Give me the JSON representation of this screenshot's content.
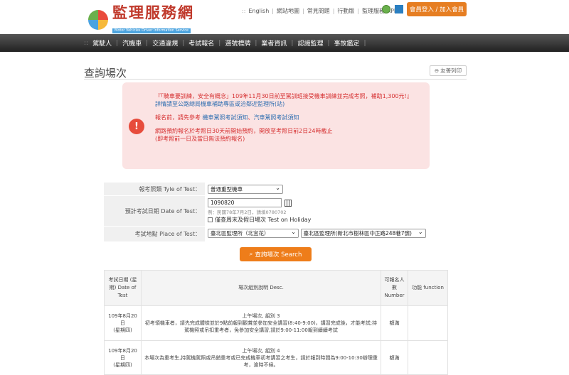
{
  "header": {
    "logo_title": "監理服務網",
    "logo_subtitle": "Motor Vehicles Driver Information Service",
    "links": [
      "English",
      "網站地圖",
      "常見問題",
      "行動版",
      "監理服務 APP"
    ],
    "login_label": "會員登入 / 加入會員"
  },
  "nav": [
    "駕駛人",
    "汽機車",
    "交通違規",
    "考試報名",
    "選號標牌",
    "業者資訊",
    "認識監理",
    "事故鑑定"
  ],
  "page": {
    "title": "查詢場次",
    "print_label": "友善列印"
  },
  "notice": {
    "line1": "『「騎車要訓練，安全有概念」109年11月30日前至駕訓班接受機車訓練並完成考照，補助1,300元!』",
    "line2": "詳情請至公路總局機車補助專區或洽鄰近監理所(站)",
    "line3_prefix": "報名前，請先參考",
    "link1": "機車駕照考試須知",
    "sep": "、",
    "link2": "汽車駕照考試須知",
    "line4": "網路預約報名於考照日30天前開始預約，開放至考照日前2日24時截止",
    "line5": "(即考照前一日及當日無法預約報名)"
  },
  "form": {
    "type_label": "報考照類 Tyle of Test：",
    "type_value": "普通重型機車",
    "date_label": "預計考試日期 Date of Test：",
    "date_value": "1090820",
    "date_hint": "例：民國78年7月2日，請填0780702",
    "holiday_label": "僅查周末及假日場次 Test on Holiday",
    "place_label": "考試地點 Place of Test：",
    "place_value1": "臺北區監理所（北宜花）",
    "place_value2": "臺北區監理所(新北市樹林區中正路248巷7號)"
  },
  "search_label": "查詢場次 Search",
  "table": {
    "headers": [
      "考試日期 (星期) Date of Test",
      "場次組別說明 Desc.",
      "可報名人數 Number",
      "功能 function"
    ],
    "rows": [
      {
        "date": "109年8月20日",
        "weekday": "(星期四)",
        "desc_title": "上午場次, 組別 3",
        "desc_body": "初考領機車者，請先完成體檢並於9點前報到觀賞並參加安全講習(8:40-9:00)，講習完成後，才能考試;持駕機照或吊扣重考者，免參加安全講習,請於9:00-11:00報到續續考試",
        "number": "額滿",
        "function": ""
      },
      {
        "date": "109年8月20日",
        "weekday": "(星期四)",
        "desc_title": "上午場次, 組別 4",
        "desc_body": "本場次為重考生,持駕機駕照或吊銷重考或已完成機車初考講習之考生，請於報到時間為9:00-10:30辦理重考，逾時不候。",
        "number": "額滿",
        "function": ""
      }
    ]
  }
}
